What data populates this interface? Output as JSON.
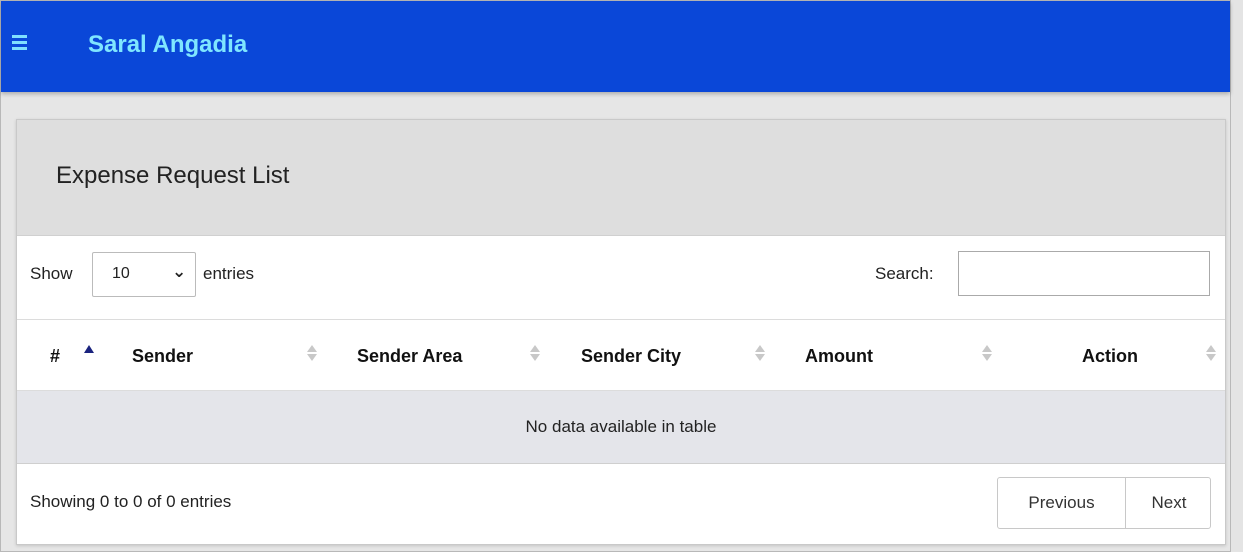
{
  "app": {
    "title": "Saral Angadia",
    "menu_icon": "hamburger-menu-icon",
    "brand_color": "#0a47d8",
    "title_color": "#7fe6ff"
  },
  "card": {
    "title": "Expense Request List"
  },
  "controls": {
    "show_label": "Show",
    "page_length": "10",
    "entries_label": "entries",
    "search_label": "Search:",
    "search_value": ""
  },
  "table": {
    "columns": [
      "#",
      "Sender",
      "Sender Area",
      "Sender City",
      "Amount",
      "Action"
    ],
    "sorted_column": "#",
    "sort_direction": "ascending",
    "empty_message": "No data available in table"
  },
  "footer": {
    "info": "Showing 0 to 0 of 0 entries",
    "previous_label": "Previous",
    "next_label": "Next"
  }
}
